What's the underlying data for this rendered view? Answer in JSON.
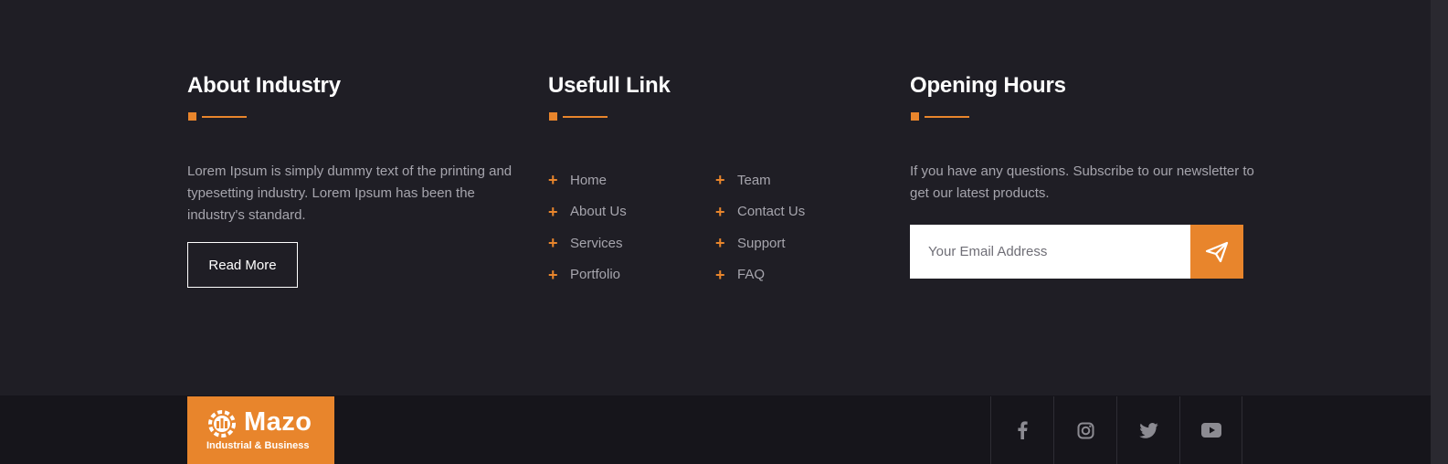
{
  "about": {
    "title": "About Industry",
    "text": "Lorem Ipsum is simply dummy text of the printing and typesetting industry. Lorem Ipsum has been the industry's standard.",
    "button": "Read More"
  },
  "links": {
    "title": "Usefull Link",
    "column1": [
      "Home",
      "About Us",
      "Services",
      "Portfolio"
    ],
    "column2": [
      "Team",
      "Contact Us",
      "Support",
      "FAQ"
    ]
  },
  "hours": {
    "title": "Opening Hours",
    "text": "If you have any questions. Subscribe to our newsletter to get our latest products.",
    "email_placeholder": "Your Email Address"
  },
  "brand": {
    "name": "Mazo",
    "tagline": "Industrial & Business"
  },
  "social": [
    "facebook-icon",
    "instagram-icon",
    "twitter-icon",
    "youtube-icon"
  ],
  "colors": {
    "accent": "#e8852c",
    "background": "#1f1e25",
    "bottom_bar": "#16151b",
    "muted_text": "#a6a5ad"
  }
}
